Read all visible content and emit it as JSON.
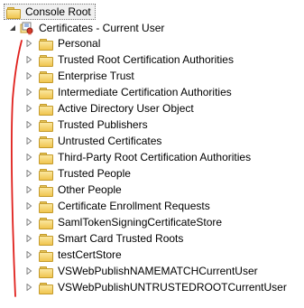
{
  "tree": {
    "root": {
      "label": "Console Root",
      "icon": "folder-icon"
    },
    "store": {
      "label": "Certificates - Current User",
      "icon": "certificate-store-icon",
      "expanded": true
    },
    "items": [
      {
        "label": "Personal"
      },
      {
        "label": "Trusted Root Certification Authorities"
      },
      {
        "label": "Enterprise Trust"
      },
      {
        "label": "Intermediate Certification Authorities"
      },
      {
        "label": "Active Directory User Object"
      },
      {
        "label": "Trusted Publishers"
      },
      {
        "label": "Untrusted Certificates"
      },
      {
        "label": "Third-Party Root Certification Authorities"
      },
      {
        "label": "Trusted People"
      },
      {
        "label": "Other People"
      },
      {
        "label": "Certificate Enrollment Requests"
      },
      {
        "label": "SamlTokenSigningCertificateStore"
      },
      {
        "label": "Smart Card Trusted Roots"
      },
      {
        "label": "testCertStore"
      },
      {
        "label": "VSWebPublishNAMEMATCHCurrentUser"
      },
      {
        "label": "VSWebPublishUNTRUSTEDROOTCurrentUser"
      }
    ]
  },
  "colors": {
    "annotation": "#e0201c",
    "folder": "#f0c54f",
    "expander": "#808080"
  }
}
